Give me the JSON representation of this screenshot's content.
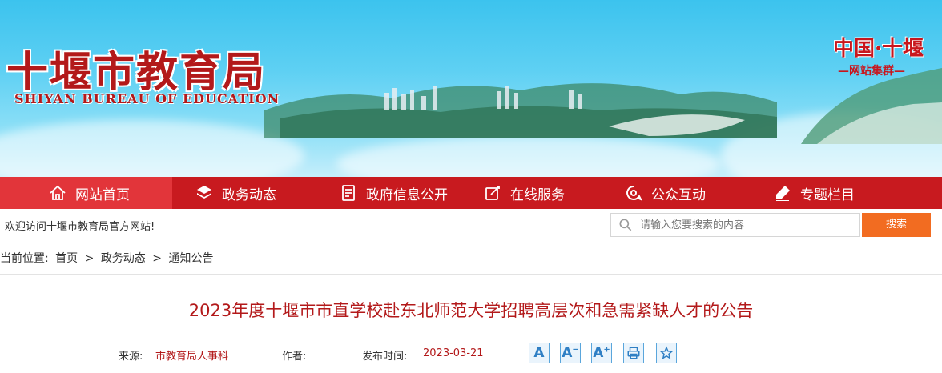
{
  "header": {
    "site_title": "十堰市教育局",
    "site_subtitle": "SHIYAN BUREAU OF EDUCATION",
    "brand": "中国·十堰",
    "brand_sub": "—网站集群—"
  },
  "nav": {
    "items": [
      {
        "label": "网站首页",
        "icon": "home-icon"
      },
      {
        "label": "政务动态",
        "icon": "layers-icon"
      },
      {
        "label": "政府信息公开",
        "icon": "document-icon"
      },
      {
        "label": "在线服务",
        "icon": "edit-icon"
      },
      {
        "label": "公众互动",
        "icon": "chat-icon"
      },
      {
        "label": "专题栏目",
        "icon": "pen-icon"
      }
    ]
  },
  "welcome": "欢迎访问十堰市教育局官方网站!",
  "search": {
    "placeholder": "请输入您要搜索的内容",
    "button": "搜索"
  },
  "breadcrumb": {
    "label": "当前位置:",
    "items": [
      "首页",
      "政务动态",
      "通知公告"
    ],
    "separator": ">"
  },
  "article": {
    "title": "2023年度十堰市市直学校赴东北师范大学招聘高层次和急需紧缺人才的公告",
    "source_label": "来源:",
    "source": "市教育局人事科",
    "author_label": "作者:",
    "author": "",
    "date_label": "发布时间:",
    "date": "2023-03-21",
    "tools": [
      "A",
      "A-",
      "A+",
      "print",
      "favorite"
    ]
  }
}
